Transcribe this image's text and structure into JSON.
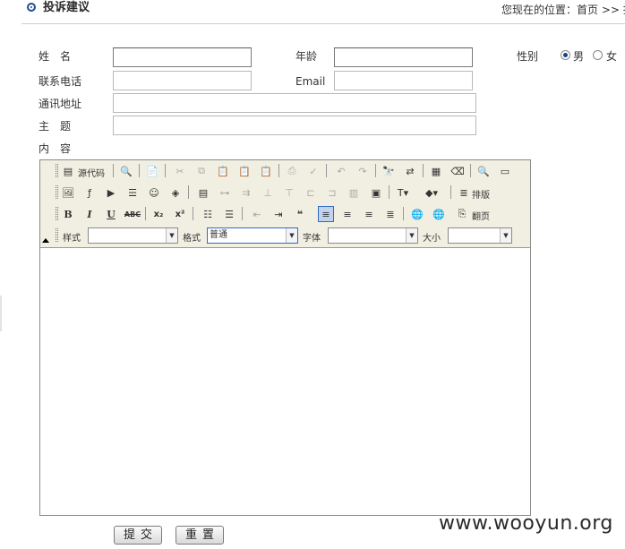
{
  "header": {
    "title": "投诉建议",
    "location": "您现在的位置：首页 >> 投"
  },
  "form": {
    "name_label": "姓　名",
    "age_label": "年龄",
    "gender_label": "性别",
    "gender_options": [
      "男",
      "女"
    ],
    "gender_selected": "男",
    "phone_label": "联系电话",
    "email_label": "Email",
    "address_label": "通讯地址",
    "subject_label": "主　题",
    "content_label": "内　容",
    "submit_label": "提交",
    "reset_label": "重置"
  },
  "editor": {
    "source_label": "源代码",
    "layout_label": "排版",
    "page_label": "翻页",
    "style_label": "样式",
    "format_label": "格式",
    "format_value": "普通",
    "font_label": "字体",
    "size_label": "大小",
    "style_value": "",
    "font_value": "",
    "size_value": ""
  },
  "watermark": "www.wooyun.org"
}
